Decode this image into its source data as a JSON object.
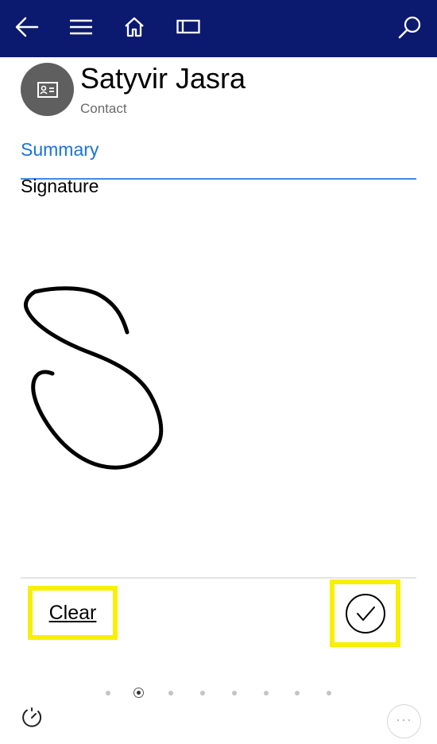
{
  "header": {
    "background": "#0b1a6e",
    "icons": [
      "back-arrow-icon",
      "menu-icon",
      "home-icon",
      "form-view-icon",
      "search-icon"
    ]
  },
  "record": {
    "name": "Satyvir Jasra",
    "type": "Contact",
    "avatar_icon": "contact-card-icon"
  },
  "tabs": {
    "active": "Summary",
    "accent": "#1a73d6"
  },
  "signature": {
    "label": "Signature",
    "clear_label": "Clear",
    "confirm_icon": "checkmark-circle-icon",
    "highlight_color": "#f8f000"
  },
  "pagination": {
    "total": 8,
    "active_index": 1
  },
  "footer": {
    "left_icon": "timer-icon",
    "right_label": "···"
  }
}
